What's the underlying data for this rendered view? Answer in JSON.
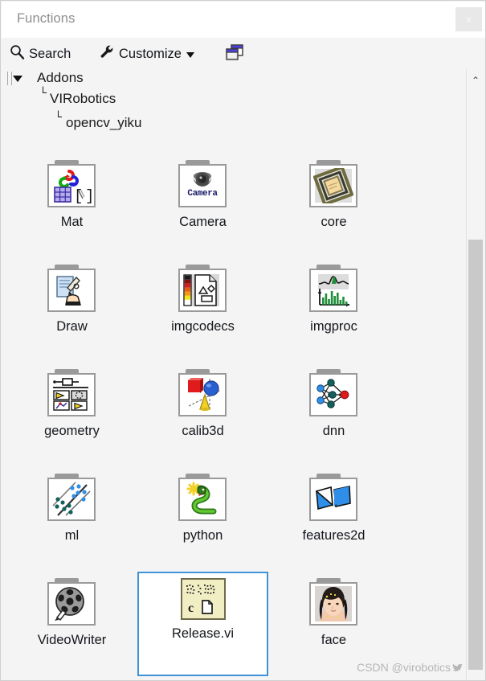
{
  "window": {
    "title": "Functions",
    "close_label": "×",
    "accent_selection": "#3e93d8",
    "background": "#f4f4f4"
  },
  "toolbar": {
    "search_label": "Search",
    "search_icon": "magnifier-icon",
    "customize_label": "Customize",
    "customize_icon": "wrench-icon",
    "customize_caret": "chevron-down-icon",
    "pin_icon": "window-pin-icon"
  },
  "breadcrumb": {
    "toggle_icon": "triangle-down-icon",
    "elbow": "└",
    "items": [
      {
        "label": "Addons",
        "level": 0
      },
      {
        "label": "VIRobotics",
        "level": 1
      },
      {
        "label": "opencv_yiku",
        "level": 2
      }
    ]
  },
  "palette": {
    "items": [
      {
        "label": "Mat",
        "icon": "mat-folder-icon",
        "type": "folder",
        "selected": false
      },
      {
        "label": "Camera",
        "icon": "camera-folder-icon",
        "type": "folder",
        "selected": false
      },
      {
        "label": "core",
        "icon": "core-folder-icon",
        "type": "folder",
        "selected": false
      },
      {
        "label": "Draw",
        "icon": "draw-folder-icon",
        "type": "folder",
        "selected": false
      },
      {
        "label": "imgcodecs",
        "icon": "imgcodecs-folder-icon",
        "type": "folder",
        "selected": false
      },
      {
        "label": "imgproc",
        "icon": "imgproc-folder-icon",
        "type": "folder",
        "selected": false
      },
      {
        "label": "geometry",
        "icon": "geometry-folder-icon",
        "type": "folder",
        "selected": false
      },
      {
        "label": "calib3d",
        "icon": "calib3d-folder-icon",
        "type": "folder",
        "selected": false
      },
      {
        "label": "dnn",
        "icon": "dnn-folder-icon",
        "type": "folder",
        "selected": false
      },
      {
        "label": "ml",
        "icon": "ml-folder-icon",
        "type": "folder",
        "selected": false
      },
      {
        "label": "python",
        "icon": "python-folder-icon",
        "type": "folder",
        "selected": false
      },
      {
        "label": "features2d",
        "icon": "features2d-folder-icon",
        "type": "folder",
        "selected": false
      },
      {
        "label": "VideoWriter",
        "icon": "videowriter-folder-icon",
        "type": "folder",
        "selected": false
      },
      {
        "label": "Release.vi",
        "icon": "release-vi-icon",
        "type": "vi",
        "selected": true
      },
      {
        "label": "face",
        "icon": "face-folder-icon",
        "type": "folder",
        "selected": false
      }
    ]
  },
  "scrollbar": {
    "up_arrow": "⌃"
  },
  "watermark": {
    "text": "CSDN @virobotics",
    "bird_icon": "bird-icon"
  }
}
